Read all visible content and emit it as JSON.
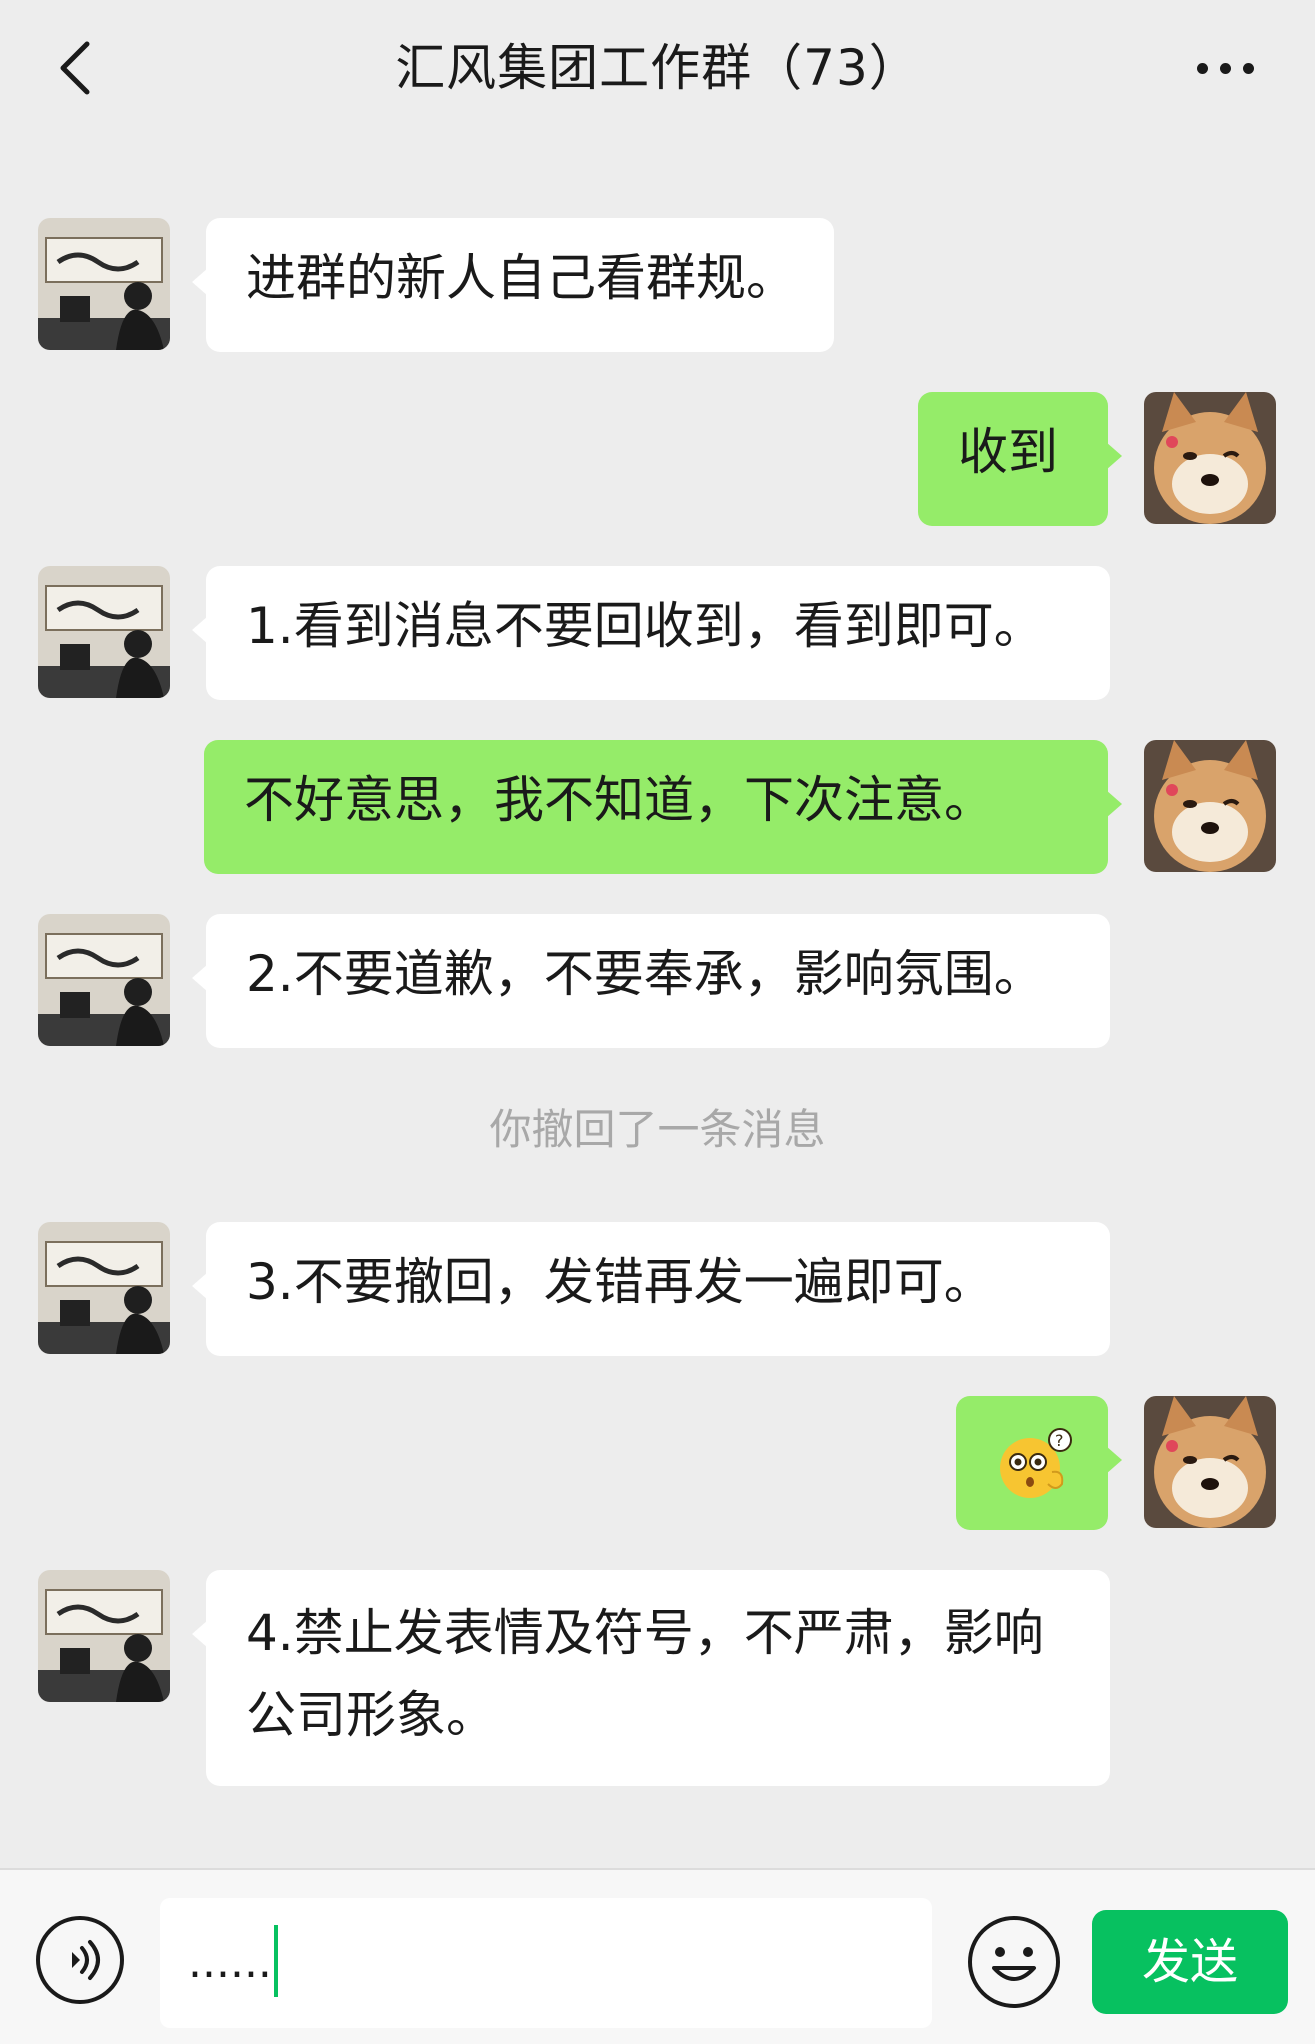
{
  "header": {
    "title": "汇风集团工作群（73）",
    "back_icon": "chevron-left-icon",
    "more_icon": "more-dots-icon"
  },
  "messages": [
    {
      "side": "in",
      "text": "进群的新人自己看群规。"
    },
    {
      "side": "out",
      "text": "收到"
    },
    {
      "side": "in",
      "text": "1.看到消息不要回收到，看到即可。"
    },
    {
      "side": "out",
      "text": "不好意思，我不知道，下次注意。"
    },
    {
      "side": "in",
      "text": "2.不要道歉，不要奉承，影响氛围。"
    },
    {
      "side": "in",
      "text": "3.不要撤回，发错再发一遍即可。"
    },
    {
      "side": "out",
      "emoji": "confused-face-emoji"
    },
    {
      "side": "in",
      "text": "4.禁止发表情及符号，不严肃，影响公司形象。"
    }
  ],
  "system_note": "你撤回了一条消息",
  "input_bar": {
    "voice_icon": "voice-icon",
    "input_value": "......",
    "emoji_icon": "emoji-icon",
    "send_label": "发送"
  },
  "colors": {
    "background": "#ededed",
    "incoming_bubble": "#ffffff",
    "outgoing_bubble": "#95ec69",
    "send_button": "#07c160",
    "system_text": "#a8a8a8"
  }
}
